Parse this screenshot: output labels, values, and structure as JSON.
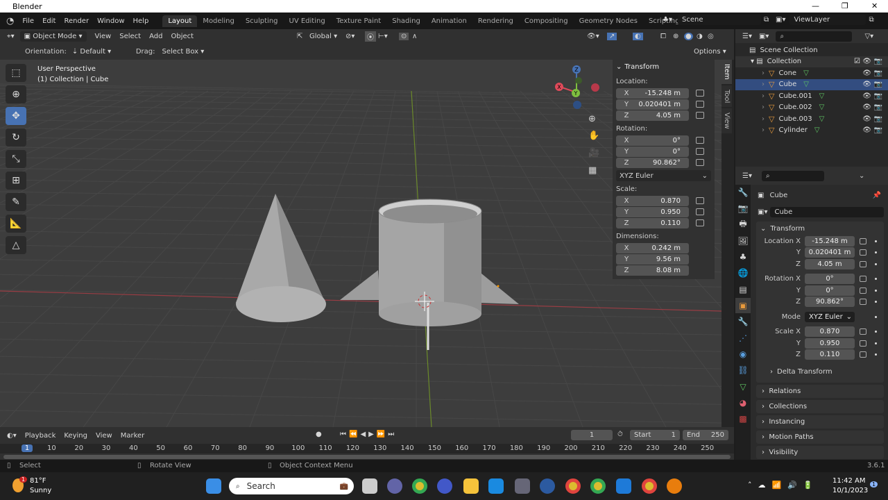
{
  "window": {
    "title": "Blender"
  },
  "topbar": {
    "menus": [
      "File",
      "Edit",
      "Render",
      "Window",
      "Help"
    ],
    "workspaces": [
      "Layout",
      "Modeling",
      "Sculpting",
      "UV Editing",
      "Texture Paint",
      "Shading",
      "Animation",
      "Rendering",
      "Compositing",
      "Geometry Nodes",
      "Scripting"
    ],
    "active_workspace": "Layout",
    "add_tab": "+",
    "scene": "Scene",
    "view_layer": "ViewLayer"
  },
  "viewport_header": {
    "mode": "Object Mode",
    "menus": [
      "View",
      "Select",
      "Add",
      "Object"
    ],
    "transform_orientation": "Global"
  },
  "tool_settings": {
    "orientation_label": "Orientation:",
    "orientation": "Default",
    "drag_label": "Drag:",
    "drag": "Select Box",
    "options": "Options"
  },
  "viewport": {
    "perspective": "User Perspective",
    "collection_info": "(1) Collection | Cube",
    "gizmo_axes": [
      "X",
      "Y",
      "Z"
    ],
    "accent": "#4772b3"
  },
  "npanel": {
    "title": "Transform",
    "location_label": "Location:",
    "location": [
      {
        "axis": "X",
        "value": "-15.248 m"
      },
      {
        "axis": "Y",
        "value": "0.020401 m"
      },
      {
        "axis": "Z",
        "value": "4.05 m"
      }
    ],
    "rotation_label": "Rotation:",
    "rotation": [
      {
        "axis": "X",
        "value": "0°"
      },
      {
        "axis": "Y",
        "value": "0°"
      },
      {
        "axis": "Z",
        "value": "90.862°"
      }
    ],
    "rotation_mode": "XYZ Euler",
    "scale_label": "Scale:",
    "scale": [
      {
        "axis": "X",
        "value": "0.870"
      },
      {
        "axis": "Y",
        "value": "0.950"
      },
      {
        "axis": "Z",
        "value": "0.110"
      }
    ],
    "dimensions_label": "Dimensions:",
    "dimensions": [
      {
        "axis": "X",
        "value": "0.242 m"
      },
      {
        "axis": "Y",
        "value": "9.56 m"
      },
      {
        "axis": "Z",
        "value": "8.08 m"
      }
    ],
    "tabs": [
      "Item",
      "Tool",
      "View"
    ]
  },
  "outliner": {
    "root": "Scene Collection",
    "collection": "Collection",
    "items": [
      "Cone",
      "Cube",
      "Cube.001",
      "Cube.002",
      "Cube.003",
      "Cylinder"
    ],
    "selected": "Cube"
  },
  "properties": {
    "object_name": "Cube",
    "datablock": "Cube",
    "transform_title": "Transform",
    "location": [
      {
        "label": "Location X",
        "value": "-15.248 m"
      },
      {
        "label": "Y",
        "value": "0.020401 m"
      },
      {
        "label": "Z",
        "value": "4.05 m"
      }
    ],
    "rotation": [
      {
        "label": "Rotation X",
        "value": "0°"
      },
      {
        "label": "Y",
        "value": "0°"
      },
      {
        "label": "Z",
        "value": "90.862°"
      }
    ],
    "mode_label": "Mode",
    "mode": "XYZ Euler",
    "scale": [
      {
        "label": "Scale X",
        "value": "0.870"
      },
      {
        "label": "Y",
        "value": "0.950"
      },
      {
        "label": "Z",
        "value": "0.110"
      }
    ],
    "delta": "Delta Transform",
    "sections": [
      "Relations",
      "Collections",
      "Instancing",
      "Motion Paths",
      "Visibility"
    ]
  },
  "timeline": {
    "menus": [
      "Playback",
      "Keying",
      "View",
      "Marker"
    ],
    "current_frame": "1",
    "start_label": "Start",
    "start": "1",
    "end_label": "End",
    "end": "250",
    "ticks": [
      "1",
      "10",
      "20",
      "30",
      "40",
      "50",
      "60",
      "70",
      "80",
      "90",
      "100",
      "110",
      "120",
      "130",
      "140",
      "150",
      "160",
      "170",
      "180",
      "190",
      "200",
      "210",
      "220",
      "230",
      "240",
      "250"
    ]
  },
  "status": {
    "select": "Select",
    "rotate": "Rotate View",
    "context": "Object Context Menu",
    "version": "3.6.1"
  },
  "taskbar": {
    "temp": "81°F",
    "weather": "Sunny",
    "weather_badge": "1",
    "search": "Search",
    "time": "11:42 AM",
    "date": "10/1/2023",
    "notif": "1"
  }
}
